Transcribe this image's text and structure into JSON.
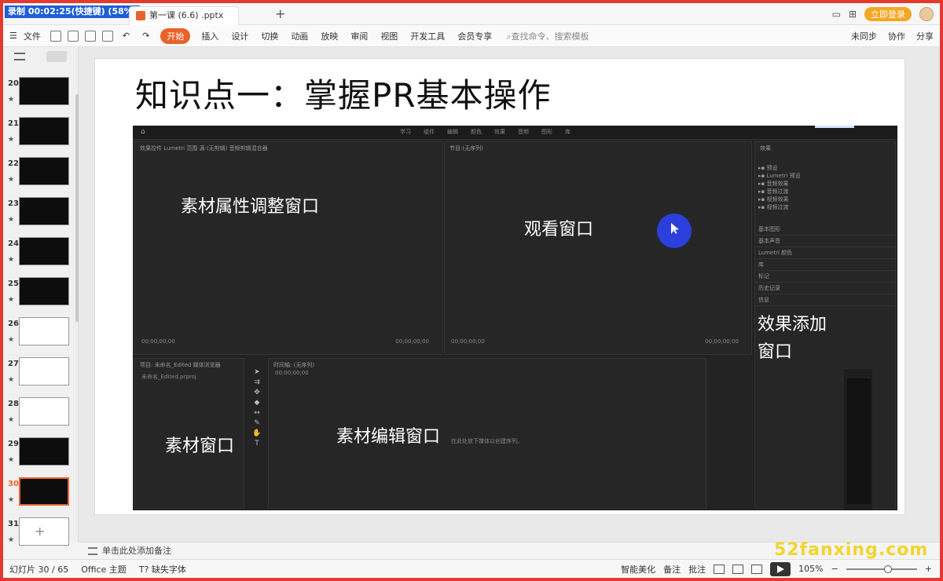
{
  "recording": {
    "label": "录制 00:02:25(快捷键) (58%)"
  },
  "titlebar": {
    "tab_label": "第一课 (6.6) .pptx",
    "tab_add": "+",
    "login_label": "立即登录"
  },
  "ribbon": {
    "file": "文件",
    "start": "开始",
    "tabs": [
      "插入",
      "设计",
      "切换",
      "动画",
      "放映",
      "审阅",
      "视图",
      "开发工具",
      "会员专享"
    ],
    "search_placeholder": "查找命令、搜索模板",
    "right": [
      "未同步",
      "协作",
      "分享"
    ]
  },
  "thumbnails": [
    {
      "num": "20",
      "light": false
    },
    {
      "num": "21",
      "light": false
    },
    {
      "num": "22",
      "light": false
    },
    {
      "num": "23",
      "light": false
    },
    {
      "num": "24",
      "light": false
    },
    {
      "num": "25",
      "light": false
    },
    {
      "num": "26",
      "light": true
    },
    {
      "num": "27",
      "light": true
    },
    {
      "num": "28",
      "light": true
    },
    {
      "num": "29",
      "light": false
    },
    {
      "num": "30",
      "light": false
    },
    {
      "num": "31",
      "light": true
    }
  ],
  "slide": {
    "title": "知识点一：掌握PR基本操作",
    "labels": {
      "properties": "素材属性调整窗口",
      "viewer": "观看窗口",
      "effects_1": "效果添加",
      "effects_2": "窗口",
      "project": "素材窗口",
      "editing": "素材编辑窗口"
    },
    "pr_menu": [
      "学习",
      "组件",
      "编辑",
      "颜色",
      "效果",
      "音频",
      "图形",
      "库"
    ],
    "source_tabs": "效果控件    Lumetri 范围    源:(无剪辑)    音频剪辑混合器",
    "program_tab": "节目:(无序列)",
    "effects_tab": "效果",
    "timecode": "00;00;00;00",
    "project_tab": "项目: 未命名_Edited    媒体浏览器",
    "project_file": "未命名_Edited.prproj",
    "timeline_tab": "时间轴: (无序列)",
    "timeline_hint": "在此处放下媒体以创建序列。",
    "effects_tree": [
      "预设",
      "Lumetri 预设",
      "音频效果",
      "音频过渡",
      "视频效果",
      "视频过渡"
    ],
    "effects_rows": [
      "基本图形",
      "基本声音",
      "Lumetri 颜色",
      "库",
      "标记",
      "历史记录",
      "信息"
    ]
  },
  "notes": {
    "placeholder": "单击此处添加备注"
  },
  "status": {
    "slide_info": "幻灯片 30 / 65",
    "theme": "Office 主题",
    "missing_font": "缺失字体",
    "beautify": "智能美化",
    "notes_btn": "备注",
    "comment_btn": "批注",
    "zoom": "105%"
  },
  "watermark": "52fanxing.com",
  "colors": {
    "accent": "#e8622a",
    "frame": "#e23b2e",
    "cursor": "#2a3fdc"
  }
}
